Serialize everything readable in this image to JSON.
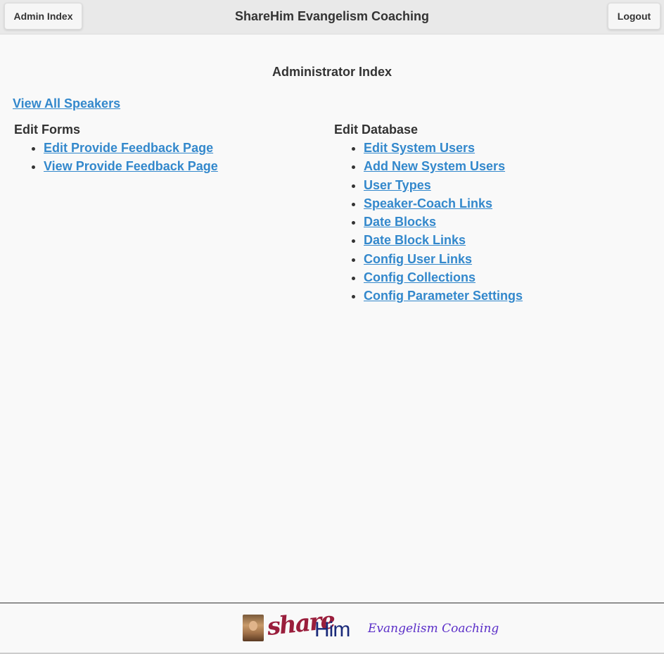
{
  "header": {
    "admin_button": "Admin Index",
    "title": "ShareHim Evangelism Coaching",
    "logout_button": "Logout"
  },
  "main": {
    "heading": "Administrator Index",
    "view_all_speakers": "View All Speakers",
    "edit_forms": {
      "heading": "Edit Forms",
      "items": [
        "Edit Provide Feedback Page",
        "View Provide Feedback Page"
      ]
    },
    "edit_database": {
      "heading": "Edit Database",
      "items": [
        "Edit System Users",
        "Add New System Users",
        "User Types",
        "Speaker-Coach Links",
        "Date Blocks",
        "Date Block Links",
        "Config User Links",
        "Config Collections",
        "Config Parameter Settings"
      ]
    }
  },
  "footer": {
    "logo_share": "share",
    "logo_him": "Him",
    "logo_tagline": "Evangelism Coaching"
  },
  "colors": {
    "link": "#3388cc",
    "header_bg": "#e9e9e9",
    "page_bg": "#f9f9f9",
    "text": "#333333",
    "logo_share": "#9a1e3c",
    "logo_him": "#1a2a7a",
    "logo_tagline": "#5a2ec8"
  }
}
